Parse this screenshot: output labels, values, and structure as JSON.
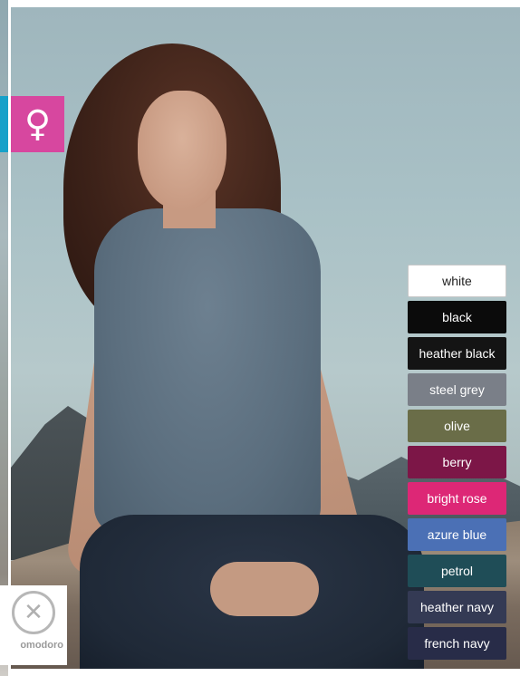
{
  "gender_badge": {
    "symbol": "♀",
    "color": "#d7479f"
  },
  "brand_badge": {
    "logo_glyph": "✕",
    "name": "omodoro"
  },
  "colors": [
    {
      "label": "white",
      "hex": "#ffffff",
      "light": true
    },
    {
      "label": "black",
      "hex": "#0b0b0b"
    },
    {
      "label": "heather black",
      "hex": "#141414"
    },
    {
      "label": "steel grey",
      "hex": "#7a7f88"
    },
    {
      "label": "olive",
      "hex": "#6a6d48"
    },
    {
      "label": "berry",
      "hex": "#7c1647"
    },
    {
      "label": "bright rose",
      "hex": "#dd2776"
    },
    {
      "label": "azure blue",
      "hex": "#4b70b5"
    },
    {
      "label": "petrol",
      "hex": "#1f4d57"
    },
    {
      "label": "heather navy",
      "hex": "#343a54"
    },
    {
      "label": "french navy",
      "hex": "#282c48"
    }
  ]
}
